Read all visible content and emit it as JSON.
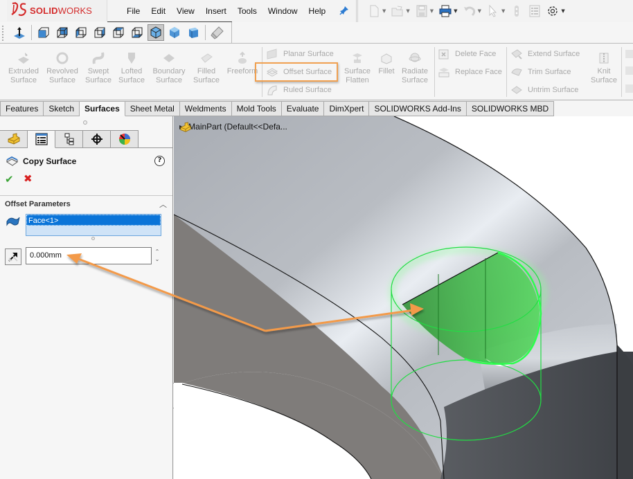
{
  "app": {
    "logo_prefix": "3S",
    "logo_bold": "SOLID",
    "logo_light": "WORKS"
  },
  "menu": {
    "items": [
      "File",
      "Edit",
      "View",
      "Insert",
      "Tools",
      "Window",
      "Help"
    ]
  },
  "quick_access": {
    "icons": [
      "new-document-icon",
      "open-folder-icon",
      "save-icon",
      "print-icon",
      "undo-icon",
      "select-arrow-icon",
      "rebuild-icon",
      "file-properties-icon",
      "options-gear-icon"
    ]
  },
  "view_toolbar": {
    "icons": [
      "normal-to-icon",
      "wireframe-view-icon",
      "hidden-lines-visible-icon",
      "hidden-lines-removed-icon",
      "wireframe-icon",
      "shaded-edges-icon",
      "shaded-box-icon",
      "shaded-with-edges-icon",
      "shaded-icon",
      "shaded-alt-icon",
      "flashlight-icon"
    ],
    "active_index": 6
  },
  "ribbon": {
    "big_buttons": [
      {
        "line1": "Extruded",
        "line2": "Surface"
      },
      {
        "line1": "Revolved",
        "line2": "Surface"
      },
      {
        "line1": "Swept",
        "line2": "Surface"
      },
      {
        "line1": "Lofted",
        "line2": "Surface"
      },
      {
        "line1": "Boundary",
        "line2": "Surface"
      },
      {
        "line1": "Filled",
        "line2": "Surface"
      },
      {
        "line1": "Freeform",
        "line2": ""
      }
    ],
    "small_group1": [
      "Planar Surface",
      "Offset Surface",
      "Ruled Surface"
    ],
    "mid_buttons": [
      {
        "line1": "Surface",
        "line2": "Flatten"
      },
      {
        "line1": "Fillet",
        "line2": ""
      },
      {
        "line1": "Radiate",
        "line2": "Surface"
      }
    ],
    "small_group2": [
      "Delete Face",
      "Replace Face"
    ],
    "small_group3": [
      "Extend Surface",
      "Trim Surface",
      "Untrim Surface"
    ],
    "knit": {
      "line1": "Knit",
      "line2": "Surface"
    },
    "highlighted": "Offset Surface",
    "highlight_color": "#f0a050"
  },
  "tabs": {
    "items": [
      "Features",
      "Sketch",
      "Surfaces",
      "Sheet Metal",
      "Weldments",
      "Mold Tools",
      "Evaluate",
      "DimXpert",
      "SOLIDWORKS Add-Ins",
      "SOLIDWORKS MBD"
    ],
    "active_index": 2
  },
  "property_manager": {
    "panel_tabs": [
      "feature-manager-icon",
      "property-manager-icon",
      "configuration-manager-icon",
      "dimxpert-manager-icon",
      "display-manager-icon"
    ],
    "active_tab": 1,
    "title": "Copy Surface",
    "help": "?",
    "ok": "✔",
    "cancel": "✖",
    "group_title": "Offset Parameters",
    "selection": "Face<1>",
    "distance": "0.000mm"
  },
  "viewport": {
    "tree_root": "MainPart  (Default<<Defa...",
    "selected_face_color": "#22dd44",
    "annotation_arrow_color": "#f39a4a"
  }
}
